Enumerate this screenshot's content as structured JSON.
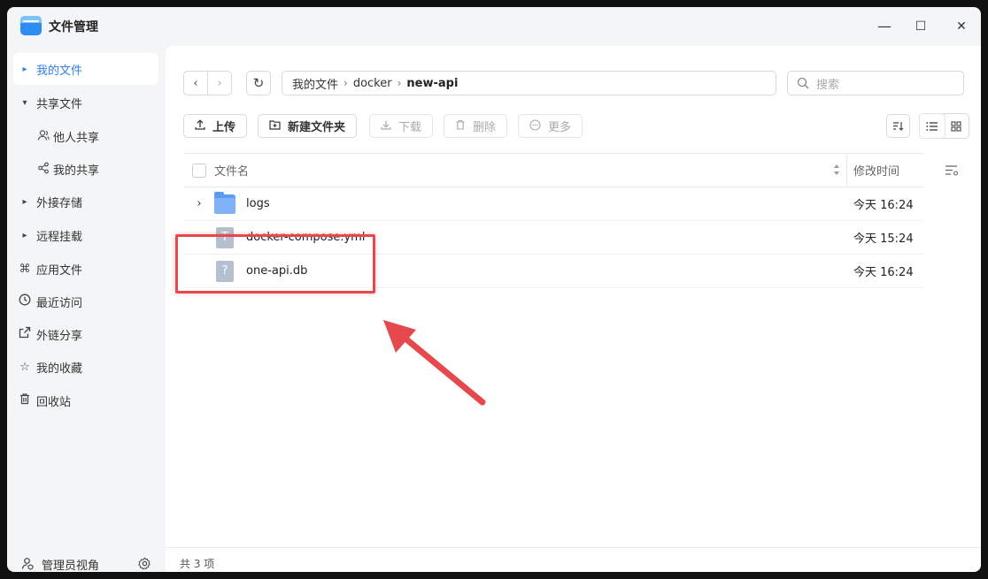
{
  "app": {
    "title": "文件管理"
  },
  "window_controls": {
    "minimize": "—",
    "maximize": "☐",
    "close": "✕"
  },
  "sidebar": {
    "items": [
      {
        "label": "我的文件"
      },
      {
        "label": "共享文件"
      },
      {
        "label": "他人共享"
      },
      {
        "label": "我的共享"
      },
      {
        "label": "外接存储"
      },
      {
        "label": "远程挂载"
      },
      {
        "label": "应用文件"
      },
      {
        "label": "最近访问"
      },
      {
        "label": "外链分享"
      },
      {
        "label": "我的收藏"
      },
      {
        "label": "回收站"
      }
    ],
    "footer_label": "管理员视角"
  },
  "nav": {
    "back": "‹",
    "forward": "›",
    "refresh": "↻"
  },
  "breadcrumb": {
    "items": [
      "我的文件",
      "docker",
      "new-api"
    ],
    "separator": "›"
  },
  "search": {
    "placeholder": "搜索"
  },
  "toolbar": {
    "upload": "上传",
    "new_folder": "新建文件夹",
    "download": "下载",
    "delete": "删除",
    "more": "更多"
  },
  "table": {
    "columns": {
      "name": "文件名",
      "modified": "修改时间"
    },
    "rows": [
      {
        "name": "logs",
        "time": "今天 16:24",
        "type": "folder"
      },
      {
        "name": "docker-compose.yml",
        "time": "今天 15:24",
        "type": "text"
      },
      {
        "name": "one-api.db",
        "time": "今天 16:24",
        "type": "unknown"
      }
    ]
  },
  "status": {
    "count_text": "共 3 项"
  },
  "colors": {
    "accent": "#2f7fe8",
    "annotation": "#e5484d",
    "folder": "#5c9bf2"
  }
}
